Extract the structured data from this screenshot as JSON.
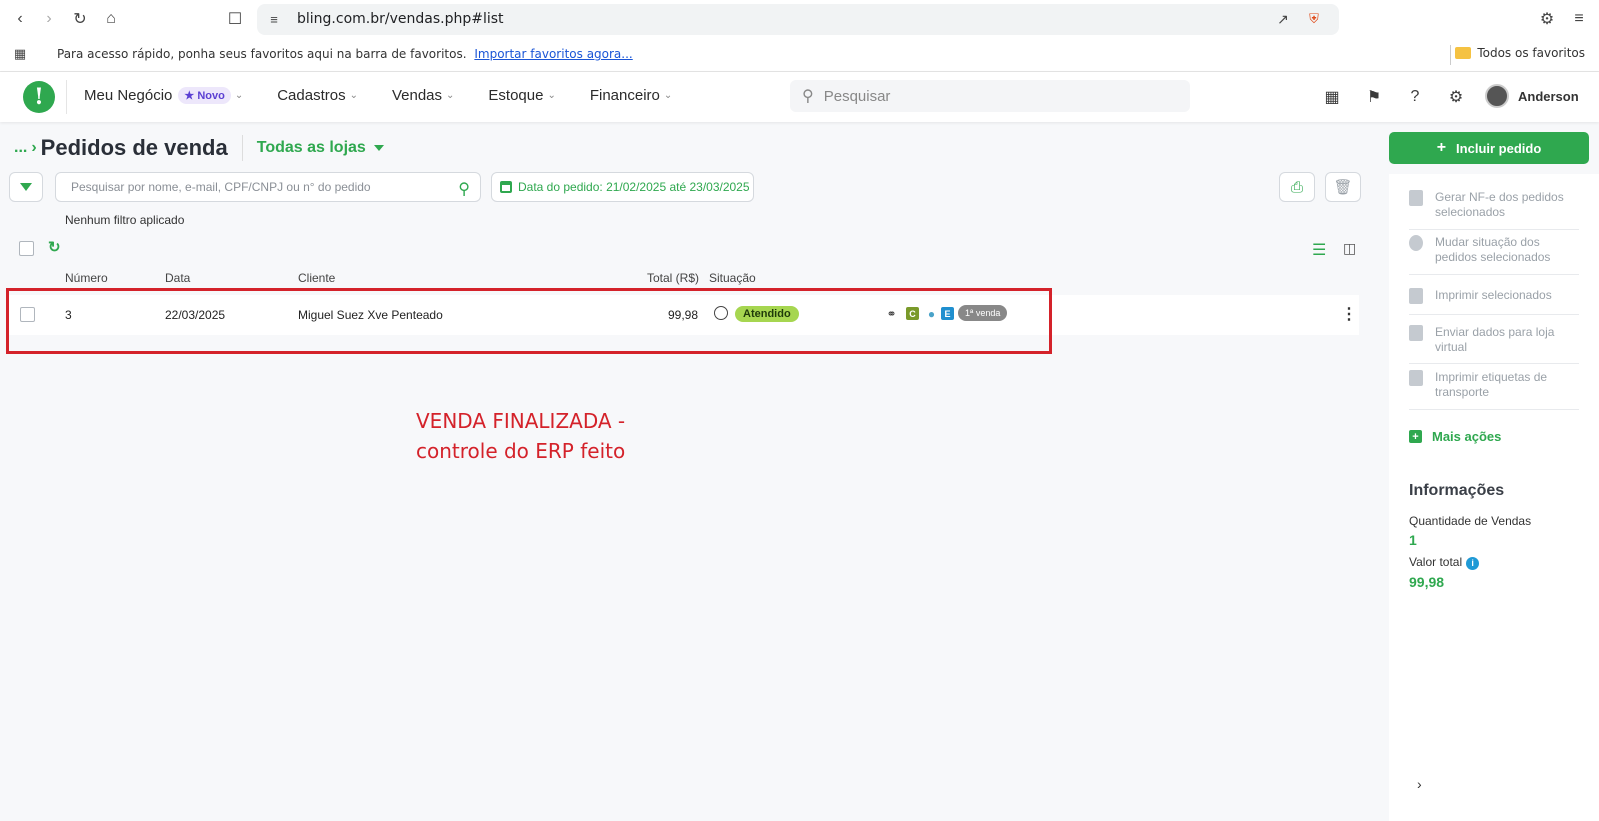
{
  "browser": {
    "url": "bling.com.br/vendas.php#list",
    "bookmarks_text": "Para acesso rápido, ponha seus favoritos aqui na barra de favoritos.",
    "bookmarks_link": "Importar favoritos agora...",
    "all_bookmarks": "Todos os favoritos"
  },
  "header": {
    "menu": [
      {
        "label": "Meu Negócio",
        "badge": "Novo"
      },
      {
        "label": "Cadastros"
      },
      {
        "label": "Vendas"
      },
      {
        "label": "Estoque"
      },
      {
        "label": "Financeiro"
      }
    ],
    "search_placeholder": "Pesquisar",
    "user_name": "Anderson"
  },
  "page": {
    "breadcrumb": "...",
    "title": "Pedidos de venda",
    "store_selector": "Todas as lojas",
    "search_placeholder": "Pesquisar por nome, e-mail, CPF/CNPJ ou n° do pedido",
    "date_filter": "Data do pedido: 21/02/2025 até 23/03/2025",
    "no_filter": "Nenhum filtro aplicado"
  },
  "table": {
    "columns": [
      "Número",
      "Data",
      "Cliente",
      "Total (R$)",
      "Situação"
    ],
    "rows": [
      {
        "numero": "3",
        "data": "22/03/2025",
        "cliente": "Miguel Suez Xve Penteado",
        "total": "99,98",
        "situacao": "Atendido",
        "tags": [
          "C",
          "E"
        ],
        "badge": "1ª venda"
      }
    ]
  },
  "annotation": {
    "line1": "VENDA FINALIZADA -",
    "line2": "controle do ERP feito"
  },
  "side": {
    "include_button": "Incluir pedido",
    "actions": [
      "Gerar NF-e dos pedidos selecionados",
      "Mudar situação dos pedidos selecionados",
      "Imprimir selecionados",
      "Enviar dados para loja virtual",
      "Imprimir etiquetas de transporte"
    ],
    "more_actions": "Mais ações",
    "info_title": "Informações",
    "qty_label": "Quantidade de Vendas",
    "qty_value": "1",
    "total_label": "Valor total",
    "total_value": "99,98"
  },
  "colors": {
    "brand_green": "#2fa84f",
    "status_green": "#a6d650",
    "highlight_red": "#d4222a"
  }
}
